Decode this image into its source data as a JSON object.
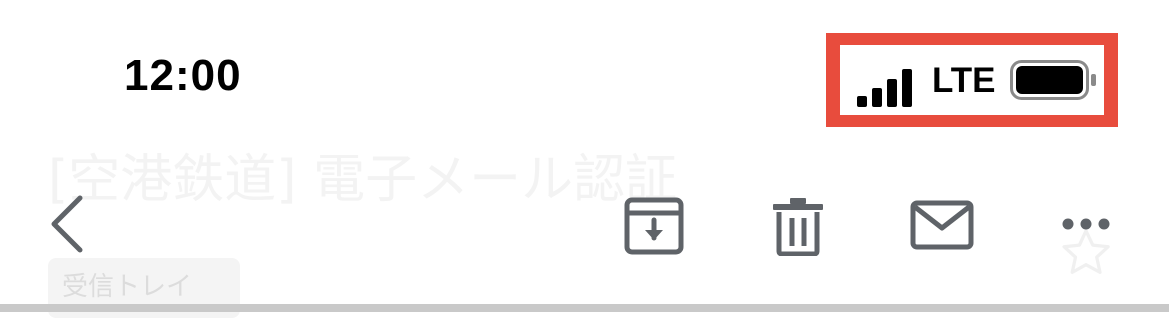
{
  "status_bar": {
    "time": "12:00",
    "network": "LTE",
    "signal_icon": "cellular-signal-icon",
    "battery_icon": "battery-full-icon",
    "highlight_color": "#e84c3d"
  },
  "email": {
    "subject": "[空港鉄道] 電子メール認証",
    "label": "受信トレイ"
  },
  "toolbar": {
    "back_icon": "chevron-left-icon",
    "archive_icon": "archive-icon",
    "delete_icon": "trash-icon",
    "mark_unread_icon": "mail-icon",
    "more_icon": "more-horizontal-icon",
    "star_icon": "star-outline-icon",
    "icon_color": "#5f6368"
  }
}
